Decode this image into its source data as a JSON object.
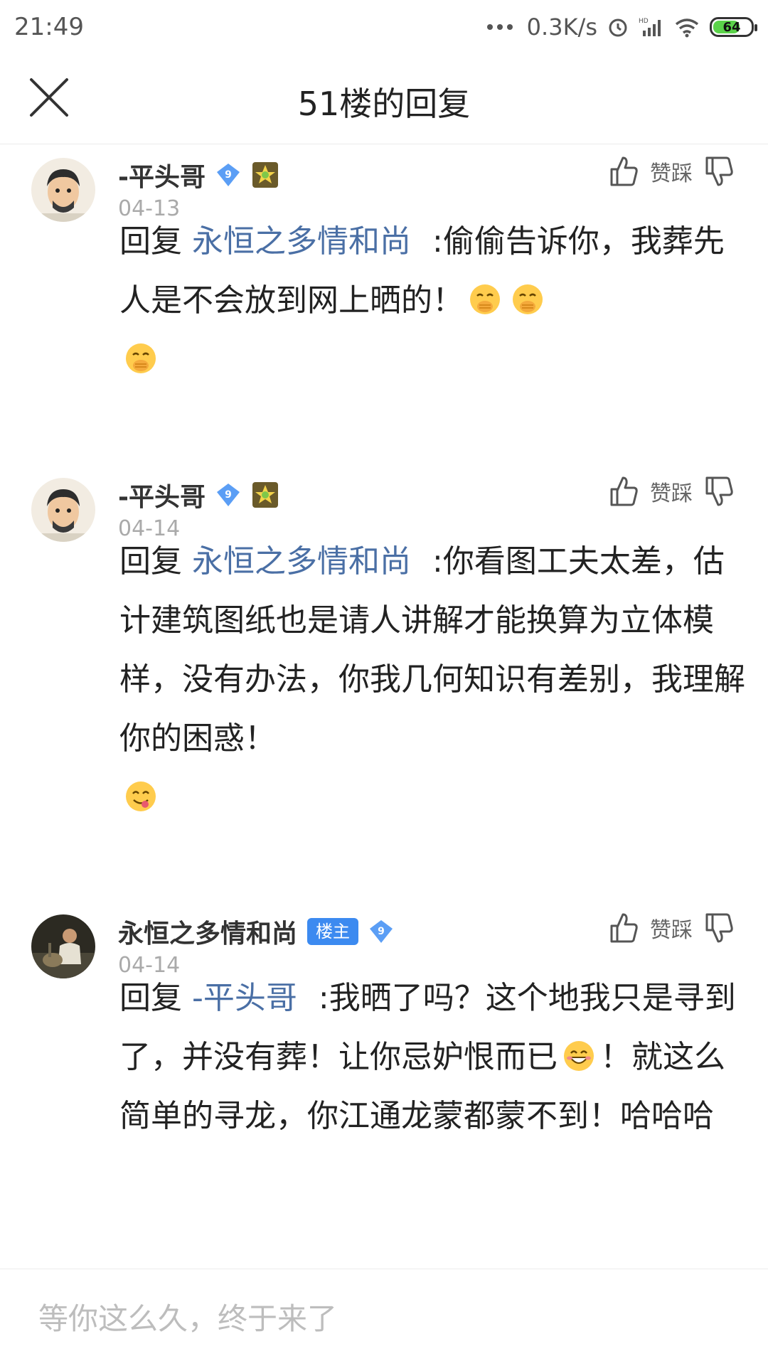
{
  "status_bar": {
    "time": "21:49",
    "net_speed": "0.3K/s",
    "battery_level": "64",
    "icons": [
      "more-dots-icon",
      "alarm-icon",
      "hd-signal-icon",
      "wifi-icon",
      "battery-icon"
    ]
  },
  "header": {
    "title": "51楼的回复",
    "close_icon": "close-icon"
  },
  "vote": {
    "label": "赞踩"
  },
  "replies": [
    {
      "username": "-平头哥",
      "level": "9",
      "date": "04-13",
      "prefix": "回复",
      "mention": "永恒之多情和尚",
      "text": ":偷偷告诉你，我葬先人是不会放到网上晒的！",
      "emojis": [
        "hand-over-mouth-emoji",
        "hand-over-mouth-emoji",
        "hand-over-mouth-emoji"
      ]
    },
    {
      "username": "-平头哥",
      "level": "9",
      "date": "04-14",
      "prefix": "回复",
      "mention": "永恒之多情和尚",
      "text": ":你看图工夫太差，估计建筑图纸也是请人讲解才能换算为立体模样，没有办法，你我几何知识有差别，我理解你的困惑！",
      "emojis": [
        "yum-emoji"
      ]
    },
    {
      "username": "永恒之多情和尚",
      "owner_badge": "楼主",
      "level": "9",
      "date": "04-14",
      "prefix": "回复",
      "mention": "-平头哥",
      "text_part1": ":我晒了吗？这个地我只是寻到了，并没有葬！让你忌妒恨而已",
      "text_part2": "！就这么简单的寻龙，你江通龙蒙都蒙不到！哈哈哈",
      "emojis": [
        "grin-emoji"
      ]
    }
  ],
  "input": {
    "placeholder": "等你这么久，终于来了"
  },
  "colors": {
    "mention": "#4a6fa5",
    "owner_badge": "#3c8af0",
    "level_badge": "#5b9ef5"
  }
}
